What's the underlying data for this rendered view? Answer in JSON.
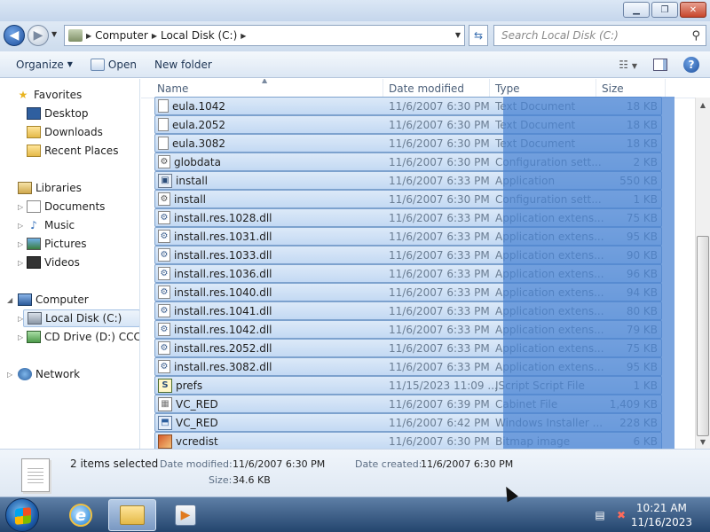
{
  "address": {
    "crumbs": [
      "Computer",
      "Local Disk (C:)"
    ],
    "search_placeholder": "Search Local Disk (C:)"
  },
  "toolbar": {
    "organize_label": "Organize",
    "open_label": "Open",
    "new_folder_label": "New folder"
  },
  "nav": {
    "favorites": "Favorites",
    "desktop": "Desktop",
    "downloads": "Downloads",
    "recent_places": "Recent Places",
    "libraries": "Libraries",
    "documents": "Documents",
    "music": "Music",
    "pictures": "Pictures",
    "videos": "Videos",
    "computer": "Computer",
    "local_disk": "Local Disk (C:)",
    "cd_drive": "CD Drive (D:) CCCOI",
    "network": "Network"
  },
  "columns": {
    "name": "Name",
    "date": "Date modified",
    "type": "Type",
    "size": "Size"
  },
  "files": [
    {
      "name": "eula.1042",
      "date": "11/6/2007 6:30 PM",
      "type": "Text Document",
      "size": "18 KB",
      "icon": "text-document-icon"
    },
    {
      "name": "eula.2052",
      "date": "11/6/2007 6:30 PM",
      "type": "Text Document",
      "size": "18 KB",
      "icon": "text-document-icon"
    },
    {
      "name": "eula.3082",
      "date": "11/6/2007 6:30 PM",
      "type": "Text Document",
      "size": "18 KB",
      "icon": "text-document-icon"
    },
    {
      "name": "globdata",
      "date": "11/6/2007 6:30 PM",
      "type": "Configuration sett...",
      "size": "2 KB",
      "icon": "configuration-file-icon"
    },
    {
      "name": "install",
      "date": "11/6/2007 6:33 PM",
      "type": "Application",
      "size": "550 KB",
      "icon": "application-icon"
    },
    {
      "name": "install",
      "date": "11/6/2007 6:30 PM",
      "type": "Configuration sett...",
      "size": "1 KB",
      "icon": "configuration-file-icon"
    },
    {
      "name": "install.res.1028.dll",
      "date": "11/6/2007 6:33 PM",
      "type": "Application extens...",
      "size": "75 KB",
      "icon": "dll-file-icon"
    },
    {
      "name": "install.res.1031.dll",
      "date": "11/6/2007 6:33 PM",
      "type": "Application extens...",
      "size": "95 KB",
      "icon": "dll-file-icon"
    },
    {
      "name": "install.res.1033.dll",
      "date": "11/6/2007 6:33 PM",
      "type": "Application extens...",
      "size": "90 KB",
      "icon": "dll-file-icon"
    },
    {
      "name": "install.res.1036.dll",
      "date": "11/6/2007 6:33 PM",
      "type": "Application extens...",
      "size": "96 KB",
      "icon": "dll-file-icon"
    },
    {
      "name": "install.res.1040.dll",
      "date": "11/6/2007 6:33 PM",
      "type": "Application extens...",
      "size": "94 KB",
      "icon": "dll-file-icon"
    },
    {
      "name": "install.res.1041.dll",
      "date": "11/6/2007 6:33 PM",
      "type": "Application extens...",
      "size": "80 KB",
      "icon": "dll-file-icon"
    },
    {
      "name": "install.res.1042.dll",
      "date": "11/6/2007 6:33 PM",
      "type": "Application extens...",
      "size": "79 KB",
      "icon": "dll-file-icon"
    },
    {
      "name": "install.res.2052.dll",
      "date": "11/6/2007 6:33 PM",
      "type": "Application extens...",
      "size": "75 KB",
      "icon": "dll-file-icon"
    },
    {
      "name": "install.res.3082.dll",
      "date": "11/6/2007 6:33 PM",
      "type": "Application extens...",
      "size": "95 KB",
      "icon": "dll-file-icon"
    },
    {
      "name": "prefs",
      "date": "11/15/2023 11:09 ...",
      "type": "JScript Script File",
      "size": "1 KB",
      "icon": "jscript-file-icon"
    },
    {
      "name": "VC_RED",
      "date": "11/6/2007 6:39 PM",
      "type": "Cabinet File",
      "size": "1,409 KB",
      "icon": "cabinet-file-icon"
    },
    {
      "name": "VC_RED",
      "date": "11/6/2007 6:42 PM",
      "type": "Windows Installer ...",
      "size": "228 KB",
      "icon": "installer-package-icon"
    },
    {
      "name": "vcredist",
      "date": "11/6/2007 6:30 PM",
      "type": "Bitmap image",
      "size": "6 KB",
      "icon": "bitmap-image-icon"
    }
  ],
  "details": {
    "selected": "2 items selected",
    "date_modified_label": "Date modified:",
    "date_modified_value": "11/6/2007 6:30 PM",
    "date_created_label": "Date created:",
    "date_created_value": "11/6/2007 6:30 PM",
    "size_label": "Size:",
    "size_value": "34.6 KB"
  },
  "clock": {
    "time": "10:21 AM",
    "date": "11/16/2023"
  },
  "icon_glyphs": {
    "text-document-icon": "",
    "configuration-file-icon": "⚙",
    "application-icon": "▣",
    "dll-file-icon": "⚙",
    "jscript-file-icon": "S",
    "cabinet-file-icon": "▦",
    "installer-package-icon": "⬒",
    "bitmap-image-icon": ""
  },
  "icon_classes": {
    "text-document-icon": "doc-ico",
    "configuration-file-icon": "cfg-ico",
    "application-icon": "app-ico",
    "dll-file-icon": "dll-ico",
    "jscript-file-icon": "js-ico",
    "cabinet-file-icon": "cab-ico",
    "installer-package-icon": "msi-ico",
    "bitmap-image-icon": "bmp-ico"
  }
}
